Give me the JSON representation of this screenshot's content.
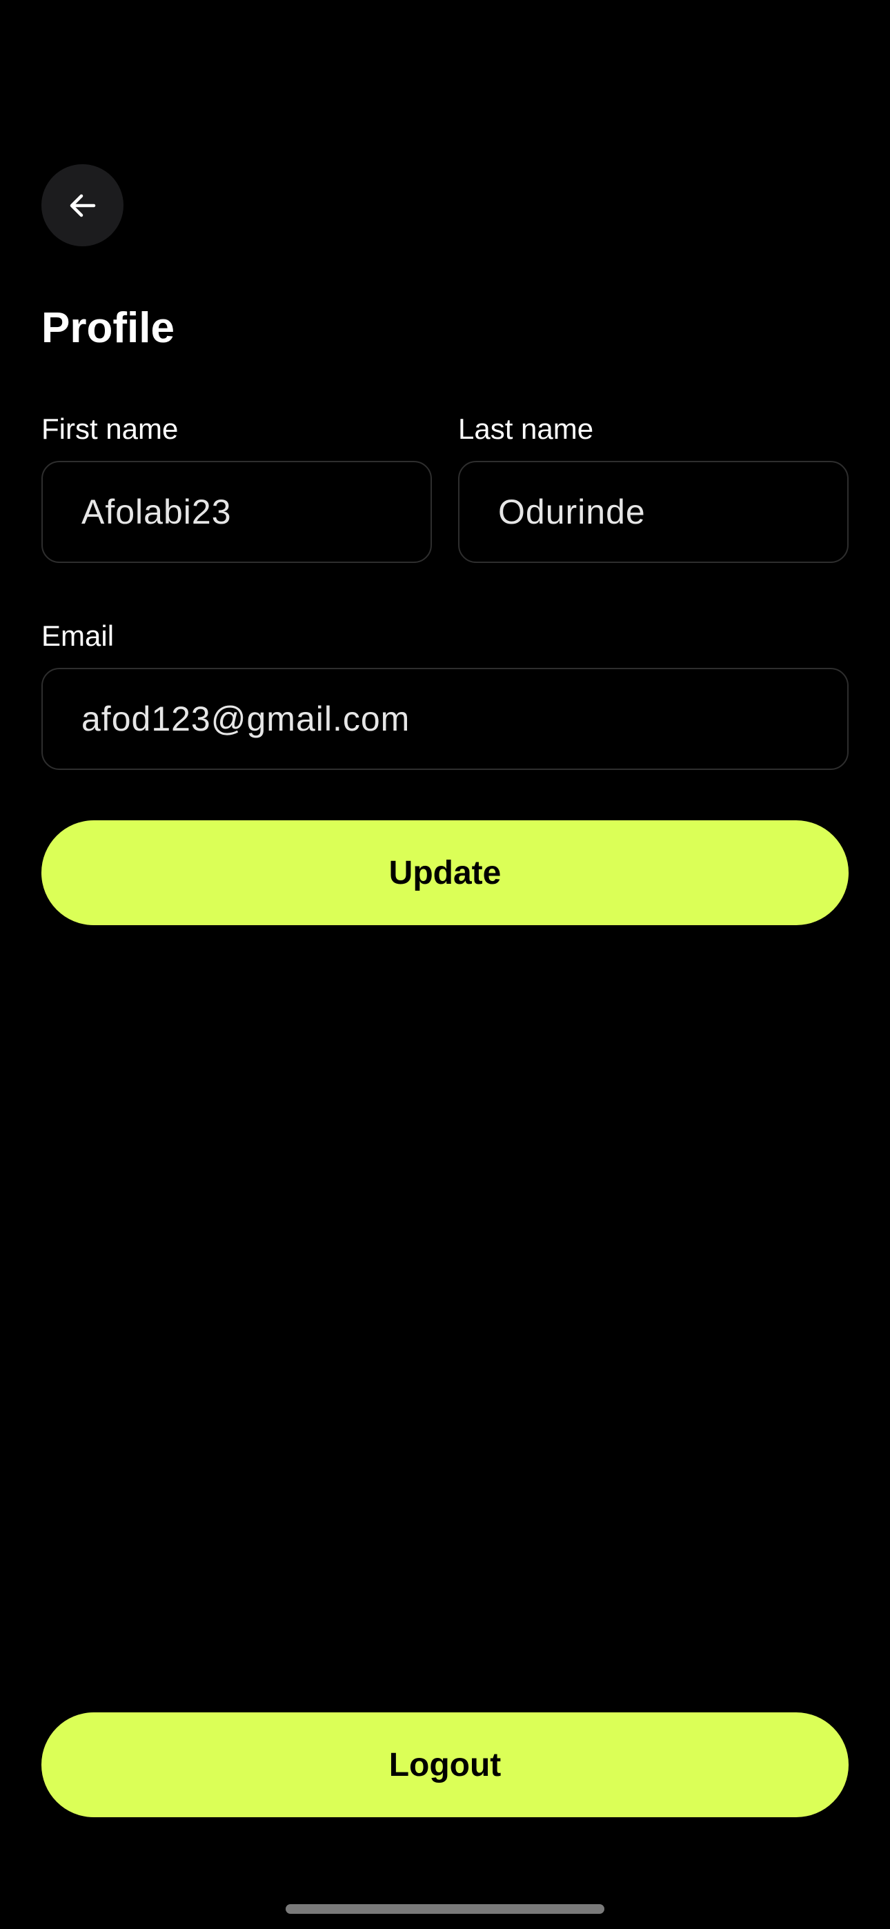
{
  "header": {
    "back_icon": "arrow-left-icon",
    "title": "Profile"
  },
  "form": {
    "first_name": {
      "label": "First name",
      "value": "Afolabi23"
    },
    "last_name": {
      "label": "Last name",
      "value": "Odurinde"
    },
    "email": {
      "label": "Email",
      "value": "afod123@gmail.com"
    }
  },
  "actions": {
    "update_label": "Update",
    "logout_label": "Logout"
  },
  "colors": {
    "background": "#000000",
    "accent": "#dbff57",
    "back_button_bg": "#1c1c1e",
    "field_border": "#2e2e2e"
  }
}
